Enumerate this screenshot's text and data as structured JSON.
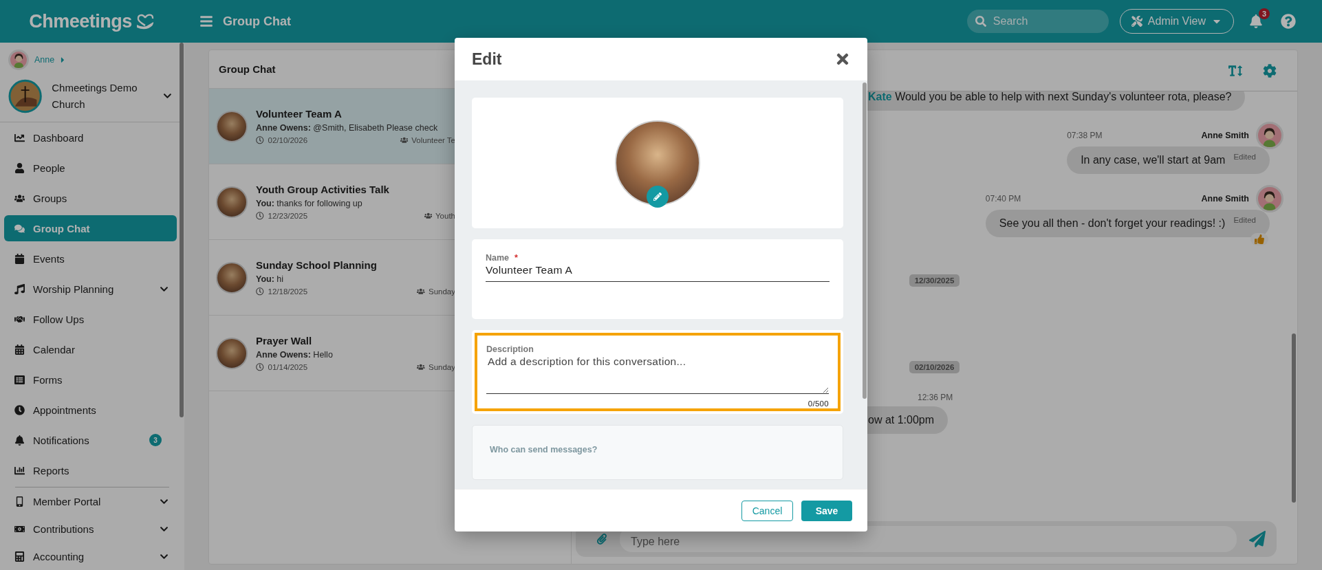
{
  "topbar": {
    "logo": "Chmeetings",
    "page_title": "Group Chat",
    "search": {
      "placeholder": "Search"
    },
    "view_button": "Admin View",
    "notification_count": "3"
  },
  "sidebar": {
    "user": "Anne",
    "church": "Chmeetings Demo Church",
    "items": [
      {
        "label": "Dashboard",
        "selected": false,
        "expandable": false
      },
      {
        "label": "People",
        "selected": false,
        "expandable": false
      },
      {
        "label": "Groups",
        "selected": false,
        "expandable": false
      },
      {
        "label": "Group Chat",
        "selected": true,
        "expandable": false
      },
      {
        "label": "Events",
        "selected": false,
        "expandable": false
      },
      {
        "label": "Worship Planning",
        "selected": false,
        "expandable": true
      },
      {
        "label": "Follow Ups",
        "selected": false,
        "expandable": false
      },
      {
        "label": "Calendar",
        "selected": false,
        "expandable": false
      },
      {
        "label": "Forms",
        "selected": false,
        "expandable": false
      },
      {
        "label": "Appointments",
        "selected": false,
        "expandable": false
      },
      {
        "label": "Notifications",
        "selected": false,
        "expandable": false,
        "badge": "3"
      },
      {
        "label": "Reports",
        "selected": false,
        "expandable": false
      }
    ],
    "footer_items": [
      {
        "label": "Member Portal",
        "selected": false,
        "expandable": true
      },
      {
        "label": "Contributions",
        "selected": false,
        "expandable": true
      },
      {
        "label": "Accounting",
        "selected": false,
        "expandable": true
      }
    ]
  },
  "chat_list": {
    "title": "Group Chat",
    "conversations": [
      {
        "name": "Volunteer Team A",
        "sender": "Anne Owens:",
        "preview": "@Smith, Elisabeth Please check",
        "date": "02/10/2026",
        "group": "Volunteer Te",
        "selected": true
      },
      {
        "name": "Youth Group Activities Talk",
        "sender": "You:",
        "preview": "thanks for following up",
        "date": "12/23/2025",
        "group": "Youth",
        "selected": false
      },
      {
        "name": "Sunday School Planning",
        "sender": "You:",
        "preview": "hi",
        "date": "12/18/2025",
        "group": "Sunday",
        "selected": false
      },
      {
        "name": "Prayer Wall",
        "sender": "Anne Owens:",
        "preview": "Hello",
        "date": "01/14/2025",
        "group": "Sunday",
        "selected": false
      }
    ]
  },
  "chat": {
    "messages": [
      {
        "kind": "incoming",
        "sender": "Kate",
        "text": "Would you be able to help with next Sunday's volunteer rota, please?"
      },
      {
        "kind": "outgoing",
        "time": "07:38 PM",
        "author": "Anne Smith",
        "text": "In any case, we'll start at 9am",
        "edited": "Edited",
        "reacted": false
      },
      {
        "kind": "outgoing",
        "time": "07:40 PM",
        "author": "Anne Smith",
        "text": "See you all then - don't forget your readings! :)",
        "edited": "Edited",
        "reacted": true
      },
      {
        "kind": "date",
        "text": "12/30/2025"
      },
      {
        "kind": "date",
        "text": "02/10/2026"
      },
      {
        "kind": "incoming",
        "time": "12:36 PM",
        "text": "ow at 1:00pm"
      }
    ],
    "input": {
      "placeholder": "Type here"
    }
  },
  "modal": {
    "title": "Edit",
    "name_field": {
      "label": "Name",
      "required_mark": "*",
      "value": "Volunteer Team A"
    },
    "description_field": {
      "label": "Description",
      "placeholder": "Add a description for this conversation...",
      "counter": "0/500",
      "highlighted": true
    },
    "permissions_heading": "Who can send messages?",
    "cancel": "Cancel",
    "save": "Save"
  }
}
